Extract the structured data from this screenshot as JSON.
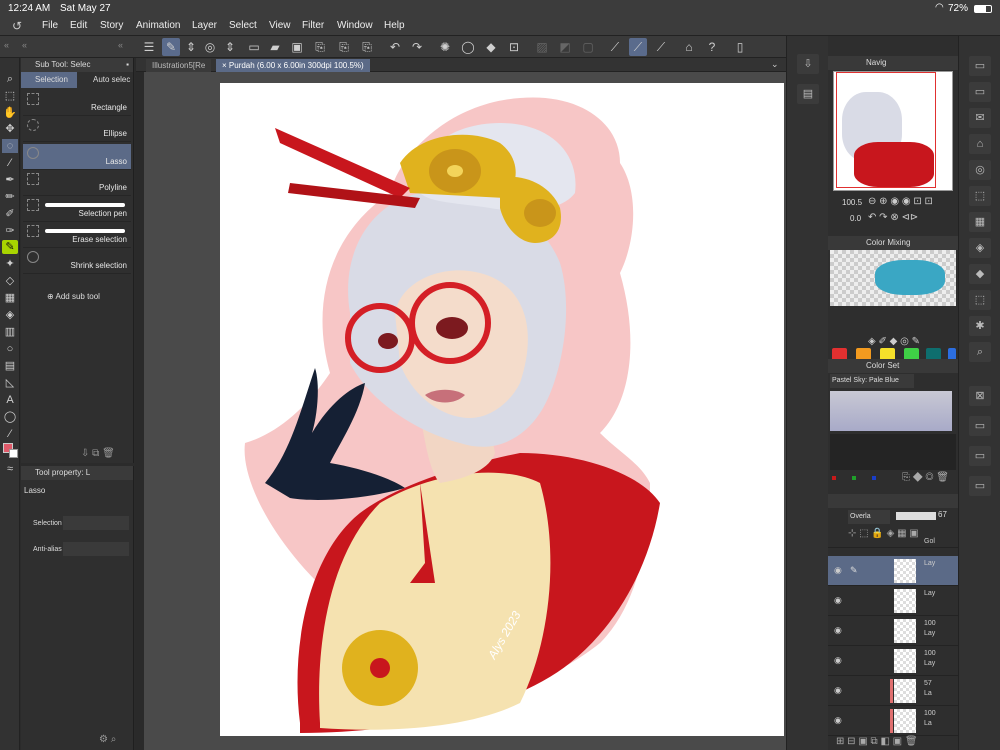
{
  "status": {
    "time": "12:24 AM",
    "date": "Sat May 27",
    "battery": "72%"
  },
  "menu": [
    "File",
    "Edit",
    "Story",
    "Animation",
    "Layer",
    "Select",
    "View",
    "Filter",
    "Window",
    "Help"
  ],
  "doc_tabs": {
    "tab1": "Illustration5[Re",
    "tab2": "Purdah (6.00 x 6.00in 300dpi 100.5%)"
  },
  "subtool": {
    "header": "Sub Tool: Selec",
    "tab_selection": "Selection",
    "tab_auto": "Auto selec",
    "items": [
      "Rectangle",
      "Ellipse",
      "Lasso",
      "Polyline",
      "Selection pen",
      "Erase selection",
      "Shrink selection"
    ],
    "add_label": "Add sub tool"
  },
  "toolprop": {
    "header": "Tool property: L",
    "tool_name": "Lasso",
    "selection_label": "Selection",
    "antialias_label": "Anti-alias"
  },
  "navigator": {
    "header": "Navig",
    "zoom": "100.5",
    "rotation": "0.0"
  },
  "color_mixing": {
    "header": "Color Mixing"
  },
  "color_set": {
    "header": "Color Set",
    "palette_name": "Pastel Sky: Pale Blue"
  },
  "layers": {
    "blend_mode": "Overla",
    "opacity": "67",
    "rows": [
      {
        "name": "Gol",
        "opacity": ""
      },
      {
        "name": "Lay",
        "opacity": ""
      },
      {
        "name": "Lay",
        "opacity": ""
      },
      {
        "name": "Lay",
        "opacity": "100"
      },
      {
        "name": "Lay",
        "opacity": "100"
      },
      {
        "name": "La",
        "opacity": "57"
      },
      {
        "name": "La",
        "opacity": "100"
      }
    ]
  },
  "signature": "Alys 2023",
  "colors": {
    "accent": "#5b6a87",
    "active_tool": "#a8d400",
    "panel": "#2f2f2f"
  }
}
